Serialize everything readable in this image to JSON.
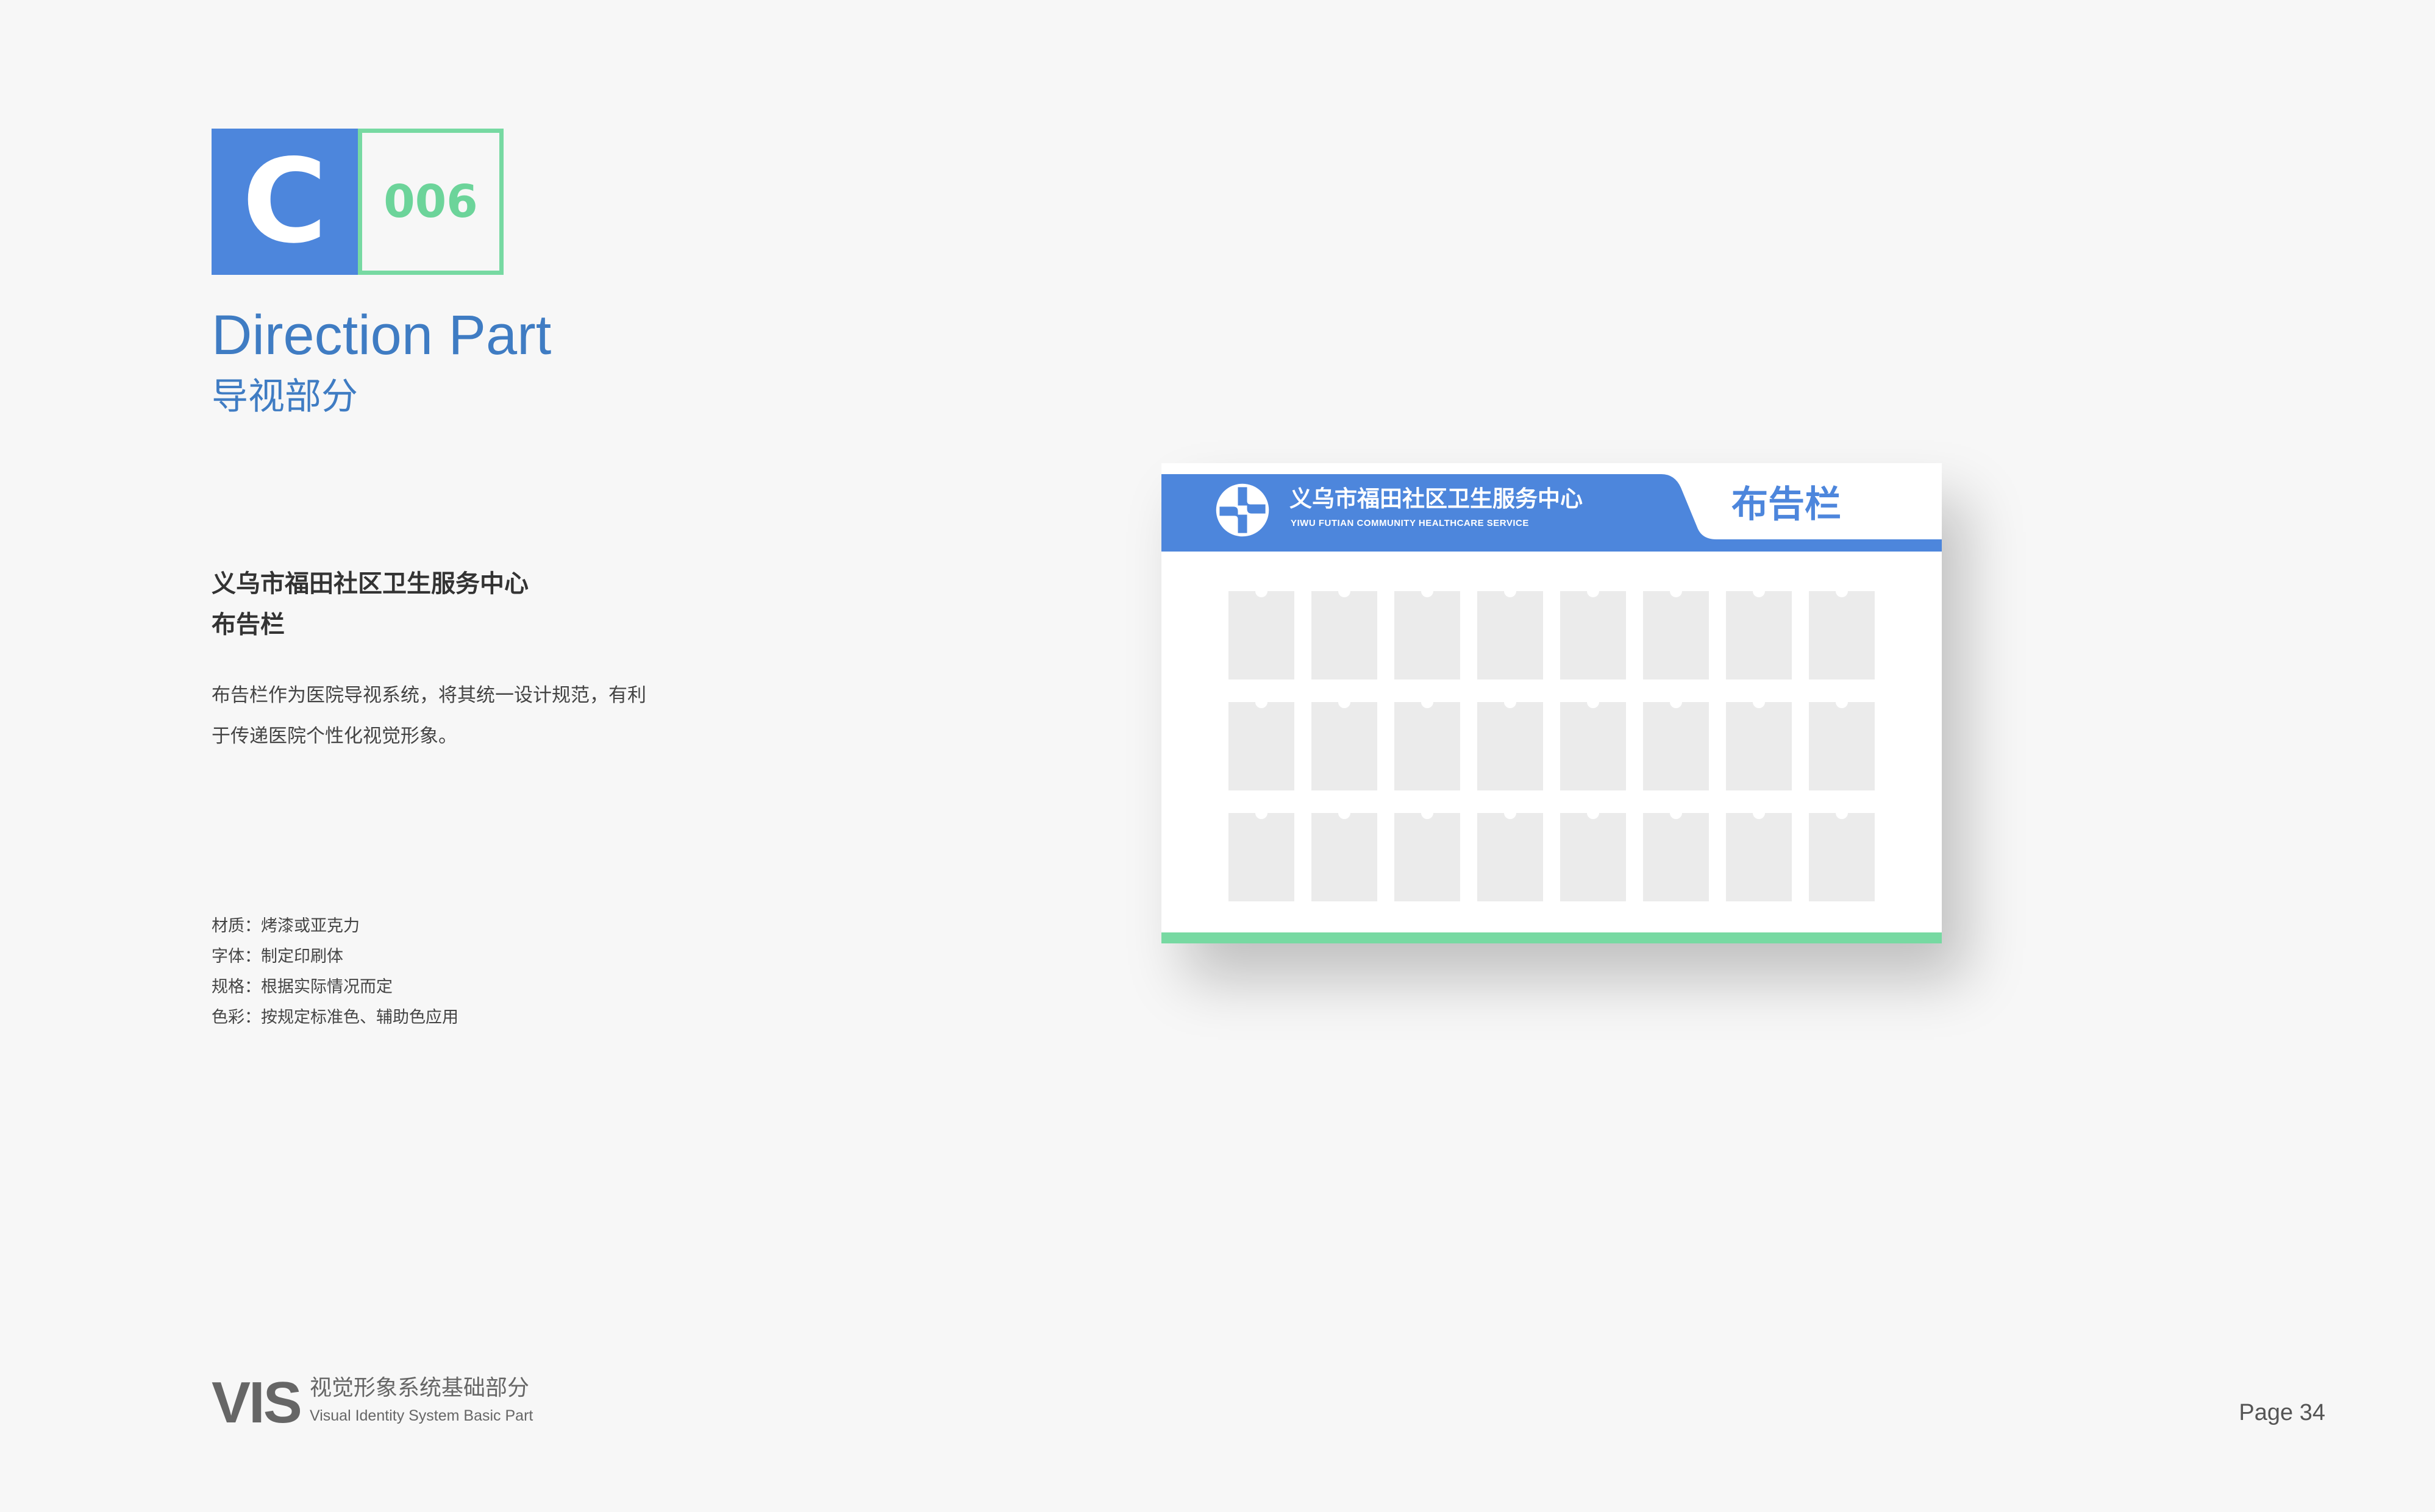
{
  "section": {
    "letter": "C",
    "number": "006",
    "title_en": "Direction Part",
    "title_cn": "导视部分"
  },
  "item": {
    "title_line1": "义乌市福田社区卫生服务中心",
    "title_line2": "布告栏",
    "description_line1": "布告栏作为医院导视系统，将其统一设计规范，有利",
    "description_line2": "于传递医院个性化视觉形象。"
  },
  "specs": {
    "material": "材质：烤漆或亚克力",
    "font": "字体：制定印刷体",
    "size": "规格：根据实际情况而定",
    "color": "色彩：按规定标准色、辅助色应用"
  },
  "board": {
    "org_name_cn": "义乌市福田社区卫生服务中心",
    "org_name_en": "YIWU FUTIAN COMMUNITY HEALTHCARE SERVICE",
    "title": "布告栏",
    "logo_icon": "healthcare-swirl-logo-icon",
    "rows": 3,
    "columns": 8
  },
  "footer": {
    "vis": "VIS",
    "cn": "视觉形象系统基础部分",
    "en": "Visual Identity System Basic Part",
    "page": "Page 34"
  },
  "colors": {
    "brand_blue": "#4d86dc",
    "title_blue": "#3f7cc3",
    "accent_green": "#77d9a2",
    "slot_gray": "#ebebeb"
  }
}
